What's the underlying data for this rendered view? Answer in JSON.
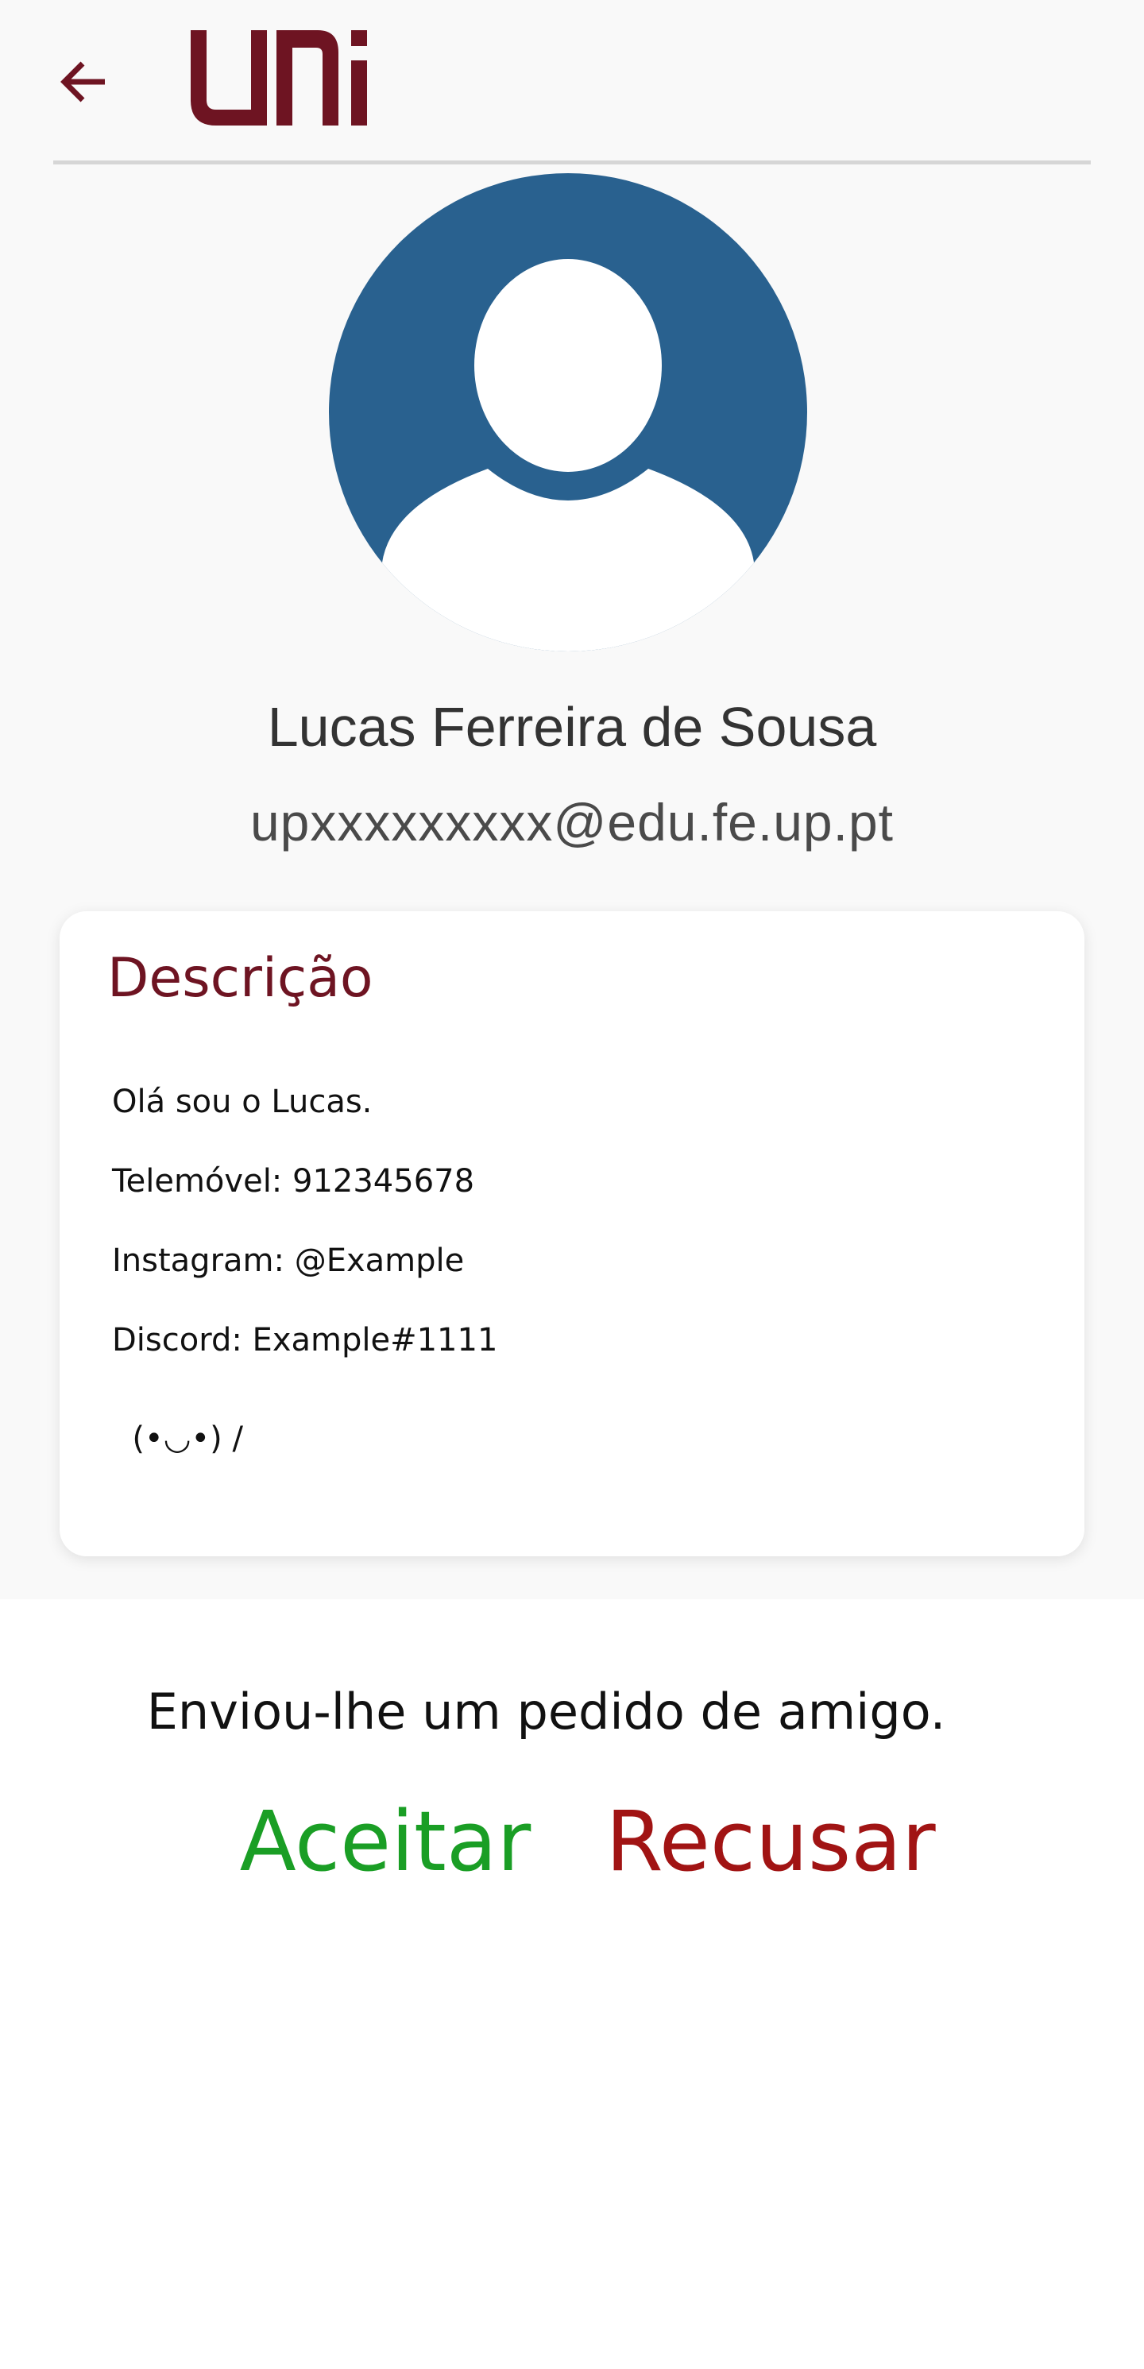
{
  "app": {
    "logo_text": "uni",
    "brand_color": "#6e1422",
    "back_icon": "arrow-left-icon",
    "avatar_icon": "user-avatar-icon",
    "avatar_color": "#29618f"
  },
  "profile": {
    "name": "Lucas Ferreira de Sousa",
    "email": "upxxxxxxxxx@edu.fe.up.pt"
  },
  "description": {
    "title": "Descrição",
    "lines": [
      "Olá sou o Lucas.",
      "Telemóvel: 912345678",
      "Instagram: @Example",
      "Discord: Example#1111",
      "  (•◡•) /"
    ]
  },
  "friend_request": {
    "message": "Enviou-lhe um pedido de amigo.",
    "accept_label": "Aceitar",
    "accept_color": "#1a9e25",
    "decline_label": "Recusar",
    "decline_color": "#a11414"
  }
}
